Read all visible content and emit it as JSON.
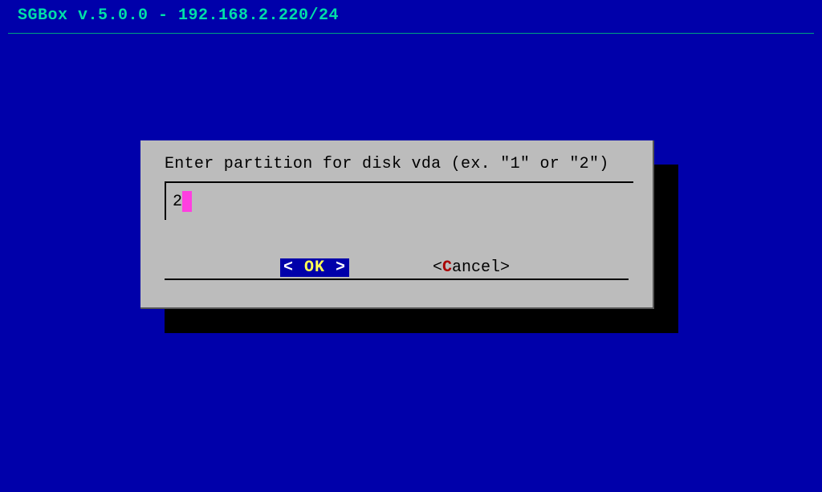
{
  "header": {
    "title": "SGBox v.5.0.0 - 192.168.2.220/24"
  },
  "dialog": {
    "prompt": "Enter partition for disk vda (ex. \"1\" or \"2\")",
    "input_value": "2",
    "buttons": {
      "ok": {
        "left_bracket": "<  ",
        "label": "OK",
        "right_bracket": "  >"
      },
      "cancel": {
        "left_bracket": "<",
        "hotkey": "C",
        "rest": "ancel",
        "right_bracket": ">"
      }
    }
  }
}
